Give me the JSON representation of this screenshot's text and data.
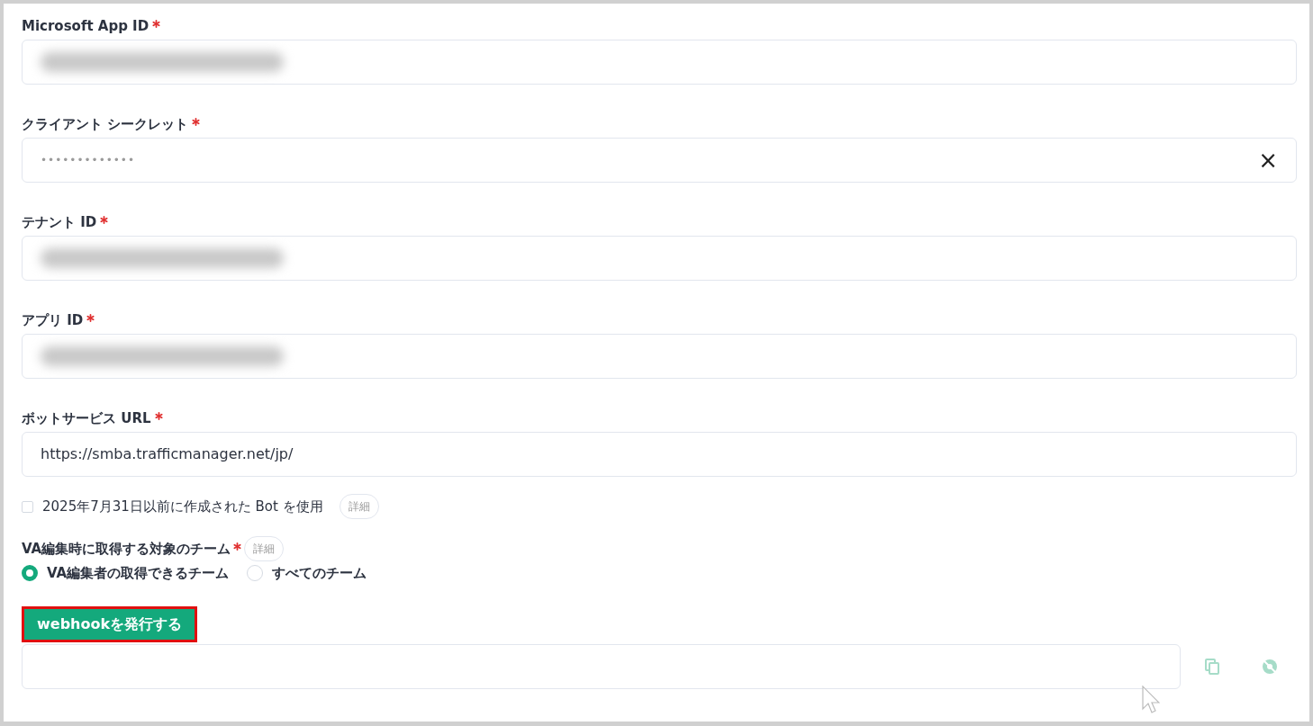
{
  "fields": [
    {
      "label": "Microsoft App ID",
      "required": true,
      "kind": "blurred"
    },
    {
      "label": "クライアント シークレット",
      "required": true,
      "kind": "masked",
      "value": "•••••••••••••",
      "clear_button": "×"
    },
    {
      "label": "テナント ID",
      "required": true,
      "kind": "blurred"
    },
    {
      "label": "アプリ ID",
      "required": true,
      "kind": "blurred"
    },
    {
      "label": "ボットサービス URL",
      "required": true,
      "kind": "text",
      "value": "https://smba.trafficmanager.net/jp/"
    }
  ],
  "legacy_bot": {
    "label": "2025年7月31日以前に作成された Bot を使用",
    "checked": false,
    "details": "詳細"
  },
  "team_scope": {
    "label": "VA編集時に取得する対象のチーム",
    "required": true,
    "details": "詳細",
    "options": [
      {
        "label": "VA編集者の取得できるチーム",
        "selected": true
      },
      {
        "label": "すべてのチーム",
        "selected": false
      }
    ]
  },
  "webhook": {
    "button": "webhookを発行する",
    "highlighted": true
  }
}
